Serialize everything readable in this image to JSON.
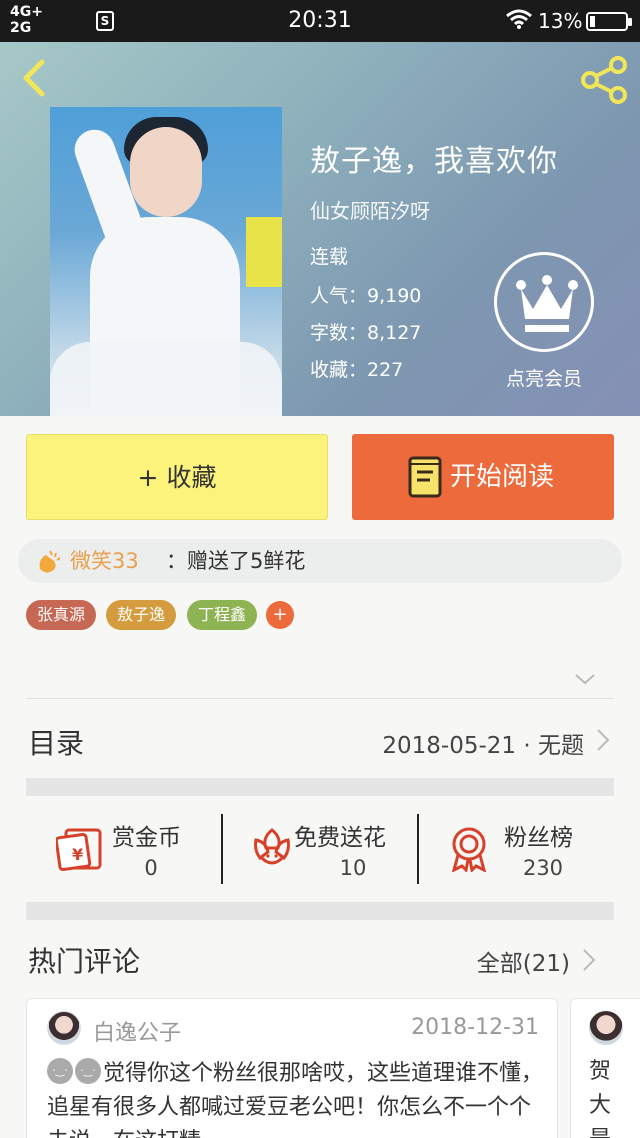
{
  "status_bar": {
    "network_top": "4G+",
    "network_bottom": "2G",
    "sim_label": "S",
    "time": "20:31",
    "battery": "13%"
  },
  "book": {
    "title": "敖子逸，我喜欢你",
    "author": "仙女顾陌汐呀",
    "status": "连载",
    "popularity": "人气：9,190",
    "word_count": "字数：8,127",
    "favorites": "收藏：227"
  },
  "vip": {
    "label": "点亮会员"
  },
  "buttons": {
    "collect": "+ 收藏",
    "read": "开始阅读"
  },
  "gift": {
    "user": "微笑33",
    "text": "：赠送了5鲜花"
  },
  "tags": [
    "张真源",
    "敖子逸",
    "丁程鑫"
  ],
  "tag_add": "+",
  "catalog": {
    "title": "目录",
    "latest": "2018-05-21 · 无题"
  },
  "actions": [
    {
      "label": "赏金币",
      "value": "0",
      "icon": "red-envelope-icon"
    },
    {
      "label": "免费送花",
      "value": "10",
      "icon": "flower-icon"
    },
    {
      "label": "粉丝榜",
      "value": "230",
      "icon": "medal-icon"
    }
  ],
  "comments": {
    "title": "热门评论",
    "all": "全部(21)",
    "items": [
      {
        "user": "白逸公子",
        "date": "2018-12-31",
        "text": "觉得你这个粉丝很那啥哎，这些道理谁不懂，追星有很多人都喊过爱豆老公吧！你怎么不一个个去说，在这打精"
      },
      {
        "text": "贺大是"
      }
    ]
  },
  "colors": {
    "accent_orange": "#ec6a3b",
    "collect_yellow": "#fbf37c",
    "icon_red": "#d7412b"
  }
}
